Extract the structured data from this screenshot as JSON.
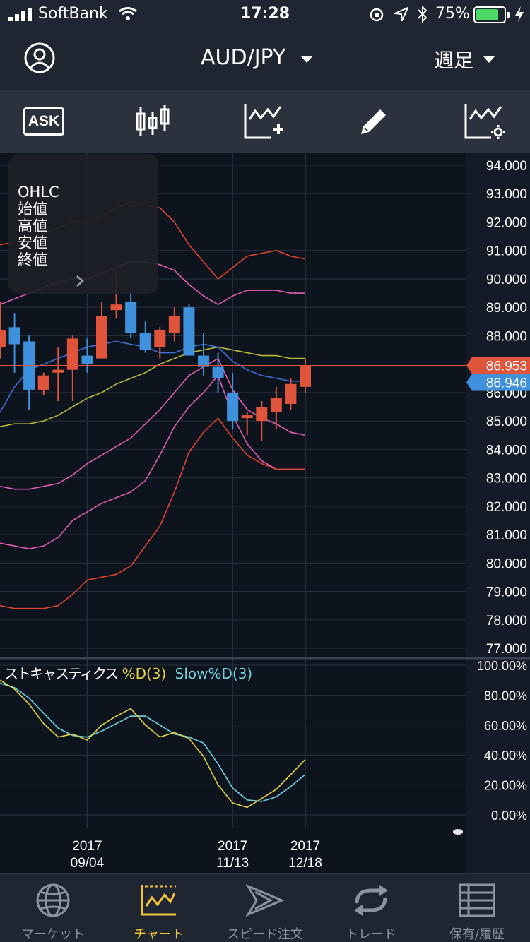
{
  "status": {
    "carrier": "SoftBank",
    "time": "17:28",
    "battery": "75%"
  },
  "nav": {
    "title": "AUD/JPY",
    "timeframe": "週足"
  },
  "toolbar": {
    "ask_label": "ASK"
  },
  "ohlc_panel": {
    "lines": [
      "OHLC",
      "始値",
      "高値",
      "安値",
      "終値"
    ]
  },
  "stochastics": {
    "name": "ストキャスティクス",
    "d_label": "%D(3)",
    "slow_label": "Slow%D(3)"
  },
  "colors": {
    "up": "#e0543c",
    "down": "#3f91dc",
    "d_line": "#e2d246",
    "slow_line": "#6fd2e2",
    "bb_outer": "#e0432e",
    "bb_inner": "#e05cb4",
    "ma_mid": "#3f6fd6",
    "ma_long": "#b8b83a"
  },
  "chart_data": {
    "type": "candlestick",
    "price_ticks": [
      "94.000",
      "93.000",
      "92.000",
      "91.000",
      "90.000",
      "89.000",
      "88.000",
      "86.000",
      "85.000",
      "84.000",
      "83.000",
      "82.000",
      "81.000",
      "80.000",
      "79.000",
      "78.000",
      "77.000"
    ],
    "price_badges": {
      "bid": "86.953",
      "ask": "86.946"
    },
    "date_labels": [
      {
        "year": "2017",
        "date": "09/04"
      },
      {
        "year": "2017",
        "date": "11/13"
      },
      {
        "year": "2017",
        "date": "12/18"
      }
    ],
    "candles": [
      {
        "o": 87.6,
        "h": 89.2,
        "l": 87.2,
        "c": 88.2
      },
      {
        "o": 88.3,
        "h": 88.8,
        "l": 86.7,
        "c": 87.7
      },
      {
        "o": 87.8,
        "h": 88.0,
        "l": 85.4,
        "c": 86.1
      },
      {
        "o": 86.1,
        "h": 86.7,
        "l": 85.9,
        "c": 86.6
      },
      {
        "o": 86.7,
        "h": 87.6,
        "l": 85.7,
        "c": 86.8
      },
      {
        "o": 86.8,
        "h": 88.0,
        "l": 85.7,
        "c": 87.9
      },
      {
        "o": 87.3,
        "h": 87.9,
        "l": 86.7,
        "c": 87.0
      },
      {
        "o": 87.2,
        "h": 89.2,
        "l": 87.2,
        "c": 88.7
      },
      {
        "o": 88.9,
        "h": 90.3,
        "l": 88.6,
        "c": 89.1
      },
      {
        "o": 89.2,
        "h": 89.6,
        "l": 87.9,
        "c": 88.1
      },
      {
        "o": 88.1,
        "h": 88.5,
        "l": 87.4,
        "c": 87.5
      },
      {
        "o": 87.6,
        "h": 88.3,
        "l": 87.2,
        "c": 88.2
      },
      {
        "o": 88.1,
        "h": 89.0,
        "l": 87.8,
        "c": 88.7
      },
      {
        "o": 89.0,
        "h": 89.1,
        "l": 87.3,
        "c": 87.3
      },
      {
        "o": 87.3,
        "h": 88.1,
        "l": 86.6,
        "c": 86.9
      },
      {
        "o": 86.9,
        "h": 87.4,
        "l": 86.0,
        "c": 86.5
      },
      {
        "o": 86.0,
        "h": 86.7,
        "l": 84.7,
        "c": 85.0
      },
      {
        "o": 85.1,
        "h": 85.3,
        "l": 84.5,
        "c": 85.2
      },
      {
        "o": 85.0,
        "h": 85.7,
        "l": 84.3,
        "c": 85.5
      },
      {
        "o": 85.3,
        "h": 86.2,
        "l": 84.7,
        "c": 85.8
      },
      {
        "o": 85.6,
        "h": 86.5,
        "l": 85.4,
        "c": 86.3
      },
      {
        "o": 86.2,
        "h": 87.2,
        "l": 86.0,
        "c": 86.95
      }
    ],
    "bb_upper2": [
      91.2,
      91.3,
      91.4,
      91.6,
      91.8,
      92.0,
      92.0,
      92.2,
      92.5,
      92.7,
      92.6,
      92.5,
      92.0,
      91.2,
      90.6,
      90.0,
      90.4,
      90.8,
      90.9,
      91.0,
      90.8,
      90.7
    ],
    "bb_upper1": [
      89.1,
      89.3,
      89.5,
      89.7,
      89.9,
      90.0,
      90.0,
      90.2,
      90.4,
      90.6,
      90.6,
      90.5,
      90.3,
      89.8,
      89.4,
      89.1,
      89.4,
      89.6,
      89.6,
      89.6,
      89.5,
      89.5
    ],
    "bb_lower1": [
      82.7,
      82.6,
      82.6,
      82.7,
      82.8,
      83.1,
      83.5,
      83.8,
      84.1,
      84.4,
      84.9,
      85.4,
      86.0,
      86.6,
      86.9,
      87.2,
      86.1,
      85.4,
      85.1,
      84.9,
      84.6,
      84.5
    ],
    "bb_lower2": [
      80.7,
      80.6,
      80.5,
      80.6,
      80.9,
      81.5,
      81.8,
      82.1,
      82.3,
      82.5,
      82.9,
      83.8,
      84.8,
      85.5,
      86.0,
      86.6,
      85.2,
      84.2,
      83.6,
      83.3,
      83.3,
      83.3
    ],
    "ma_mid": [
      85.3,
      86.2,
      86.8,
      87.0,
      87.2,
      87.4,
      87.6,
      87.7,
      87.8,
      87.7,
      87.6,
      87.4,
      87.4,
      87.6,
      87.7,
      87.6,
      87.1,
      86.8,
      86.6,
      86.5,
      86.4,
      86.4
    ],
    "ma_long": [
      84.8,
      84.9,
      84.9,
      85.0,
      85.2,
      85.5,
      85.8,
      86.0,
      86.3,
      86.5,
      86.7,
      87.0,
      87.2,
      87.4,
      87.5,
      87.6,
      87.5,
      87.4,
      87.3,
      87.3,
      87.2,
      87.2
    ],
    "bb_outer_lower": [
      78.5,
      78.4,
      78.4,
      78.4,
      78.5,
      78.9,
      79.4,
      79.5,
      79.6,
      79.9,
      80.6,
      81.3,
      82.5,
      83.9,
      84.6,
      85.1,
      84.4,
      83.8,
      83.5,
      83.3,
      83.3,
      83.3
    ],
    "stoch_ticks": [
      "100.00%",
      "80.00%",
      "60.00%",
      "40.00%",
      "20.00%",
      "0.00%"
    ],
    "stoch_d": [
      90,
      84,
      74,
      61,
      52,
      54,
      50,
      60,
      66,
      71,
      60,
      52,
      55,
      51,
      39,
      20,
      8,
      5,
      11,
      17,
      27,
      37
    ],
    "stoch_slow": [
      88,
      85,
      78,
      68,
      58,
      53,
      52,
      56,
      61,
      66,
      66,
      60,
      54,
      52,
      48,
      34,
      18,
      10,
      9,
      12,
      19,
      27
    ]
  },
  "tabs": [
    {
      "label": "マーケット"
    },
    {
      "label": "チャート"
    },
    {
      "label": "スピード注文"
    },
    {
      "label": "トレード"
    },
    {
      "label": "保有/履歴"
    }
  ]
}
